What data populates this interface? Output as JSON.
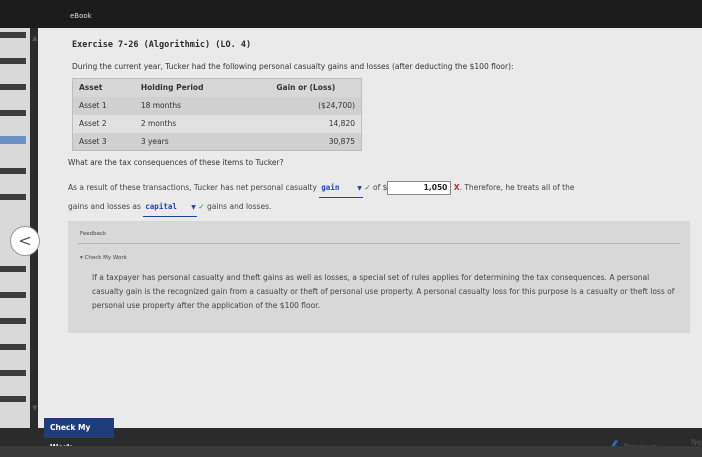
{
  "header": {
    "ebook_label": "eBook"
  },
  "exercise": {
    "title": "Exercise 7-26 (Algorithmic) (LO. 4)",
    "intro": "During the current year, Tucker had the following personal casualty gains and losses (after deducting the $100 floor):"
  },
  "table": {
    "columns": [
      "Asset",
      "Holding Period",
      "Gain or (Loss)"
    ],
    "rows": [
      [
        "Asset 1",
        "18 months",
        "($24,700)"
      ],
      [
        "Asset 2",
        "2 months",
        "14,820"
      ],
      [
        "Asset 3",
        "3 years",
        "30,875"
      ]
    ]
  },
  "question": "What are the tax consequences of these items to Tucker?",
  "answer": {
    "part1": "As a result of these transactions, Tucker has net personal casualty",
    "select1_value": "gain",
    "of_label": "of $",
    "amount_value": "1,050",
    "part2": ". Therefore, he treats all of the",
    "part3": "gains and losses as",
    "select2_value": "capital",
    "part4": "gains and losses."
  },
  "feedback": {
    "label": "Feedback",
    "check_my_work": "Check My Work",
    "text": "If a taxpayer has personal casualty and theft gains as well as losses, a special set of rules applies for determining the tax consequences. A personal casualty gain is the recognized gain from a casualty or theft of personal use property. A personal casualty loss for this purpose is a casualty or theft loss of personal use property after the application of the $100 floor."
  },
  "footer": {
    "check_button": "Check My Work",
    "previous": "Previous",
    "next": "Next"
  },
  "icons": {
    "check": "✓",
    "cross": "X",
    "back": "<",
    "prev_chevron": "❮",
    "next_chevron": "❯"
  },
  "colors": {
    "check_button_bg": "#1f3d7a",
    "correct": "#3a7b2f",
    "incorrect": "#c0262d",
    "link_blue": "#2244aa"
  }
}
